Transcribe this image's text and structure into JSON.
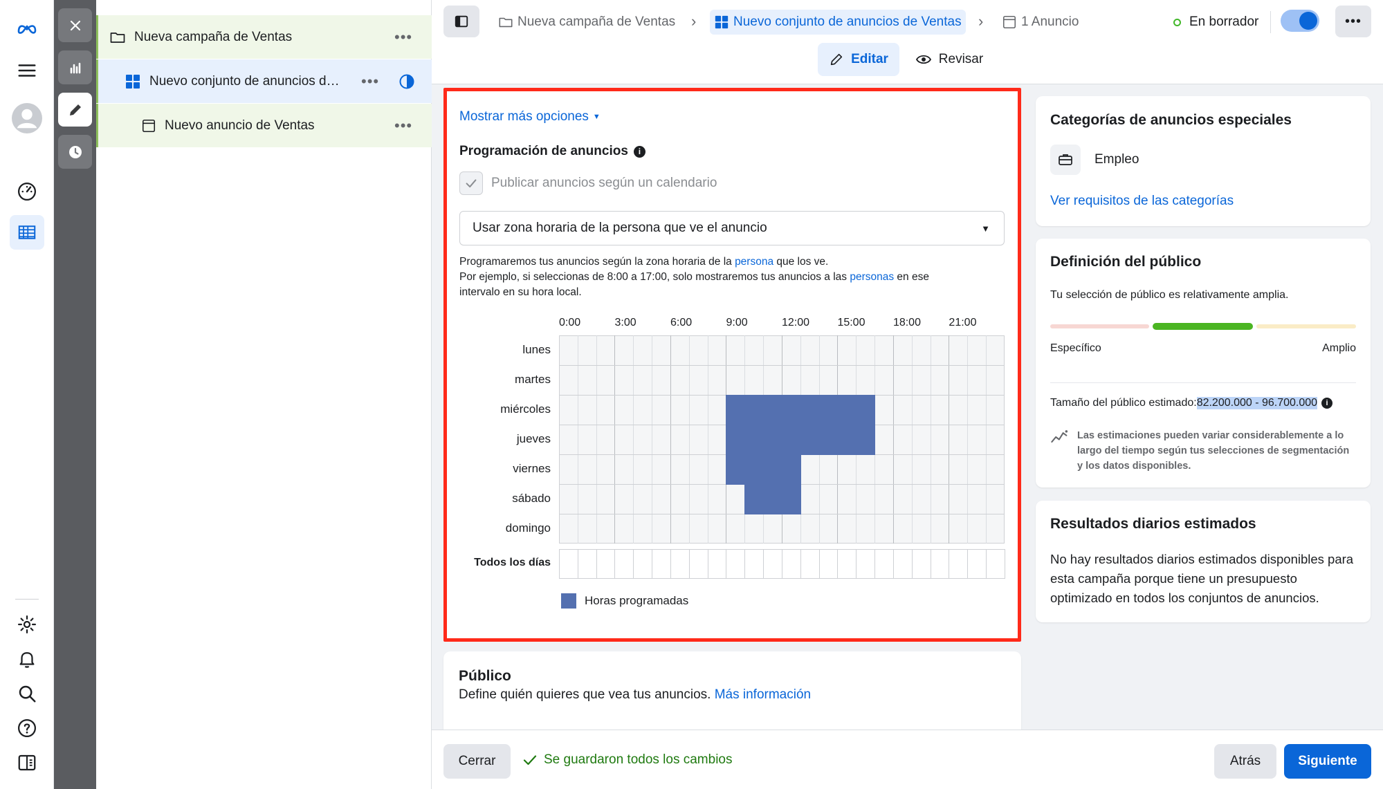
{
  "app": {
    "brand_icon": "meta-logo",
    "accent": "#0a66d8",
    "highlight_color": "#ff2a1a",
    "schedule_color": "#5470b0"
  },
  "rail": {
    "items": [
      {
        "name": "menu-icon"
      },
      {
        "name": "avatar"
      },
      {
        "name": "dashboard-icon"
      },
      {
        "name": "ads-manager-table-icon"
      },
      {
        "name": "settings-icon"
      },
      {
        "name": "notifications-icon"
      },
      {
        "name": "search-icon"
      },
      {
        "name": "help-icon"
      },
      {
        "name": "toggle-panel-icon"
      }
    ]
  },
  "tree": {
    "campaign": "Nueva campaña de Ventas",
    "adset": "Nuevo conjunto de anuncios de Ventas",
    "ad": "Nuevo anuncio de Ventas",
    "more": "•••"
  },
  "breadcrumb": {
    "campaign": "Nueva campaña de Ventas",
    "adset": "Nuevo conjunto de anuncios de Ventas",
    "ad": "1 Anuncio",
    "status": "En borrador",
    "more": "•••"
  },
  "mode_tabs": {
    "edit": "Editar",
    "review": "Revisar"
  },
  "schedule": {
    "more_options": "Mostrar más opciones",
    "title": "Programación de anuncios",
    "checkbox_label": "Publicar anuncios según un calendario",
    "checkbox_checked": true,
    "timezone_select": "Usar zona horaria de la persona que ve el anuncio",
    "desc1_a": "Programaremos tus anuncios según la zona horaria de la ",
    "desc1_link": "persona",
    "desc1_b": " que los ve.",
    "desc2_a": "Por ejemplo, si seleccionas de 8:00 a 17:00, solo mostraremos tus anuncios a las ",
    "desc2_link": "personas",
    "desc2_b": " en ese",
    "desc3": "intervalo en su hora local.",
    "hour_labels": [
      "0:00",
      "3:00",
      "6:00",
      "9:00",
      "12:00",
      "15:00",
      "18:00",
      "21:00"
    ],
    "days": [
      "lunes",
      "martes",
      "miércoles",
      "jueves",
      "viernes",
      "sábado",
      "domingo"
    ],
    "all_days": "Todos los días",
    "legend": "Horas programadas",
    "scheduled_hours": [
      [],
      [],
      [
        9,
        10,
        11,
        12,
        13,
        14,
        15,
        16
      ],
      [
        9,
        10,
        11,
        12,
        13,
        14,
        15,
        16
      ],
      [
        9,
        10,
        11,
        12
      ],
      [
        10,
        11,
        12
      ],
      []
    ]
  },
  "audience_section": {
    "title": "Público",
    "desc": "Define quién quieres que vea tus anuncios.",
    "link": "Más información"
  },
  "special_categories": {
    "title": "Categorías de anuncios especiales",
    "item": "Empleo",
    "link": "Ver requisitos de las categorías"
  },
  "audience_definition": {
    "title": "Definición del público",
    "desc": "Tu selección de público es relativamente amplia.",
    "specific": "Específico",
    "broad": "Amplio",
    "size_label": "Tamaño del público estimado: ",
    "size_value": "82.200.000 - 96.700.000",
    "note": "Las estimaciones pueden variar considerablemente a lo largo del tiempo según tus selecciones de segmentación y los datos disponibles."
  },
  "daily_results": {
    "title": "Resultados diarios estimados",
    "text": "No hay resultados diarios estimados disponibles para esta campaña porque tiene un presupuesto optimizado en todos los conjuntos de anuncios."
  },
  "footer": {
    "close": "Cerrar",
    "saved": "Se guardaron todos los cambios",
    "back": "Atrás",
    "next": "Siguiente"
  }
}
